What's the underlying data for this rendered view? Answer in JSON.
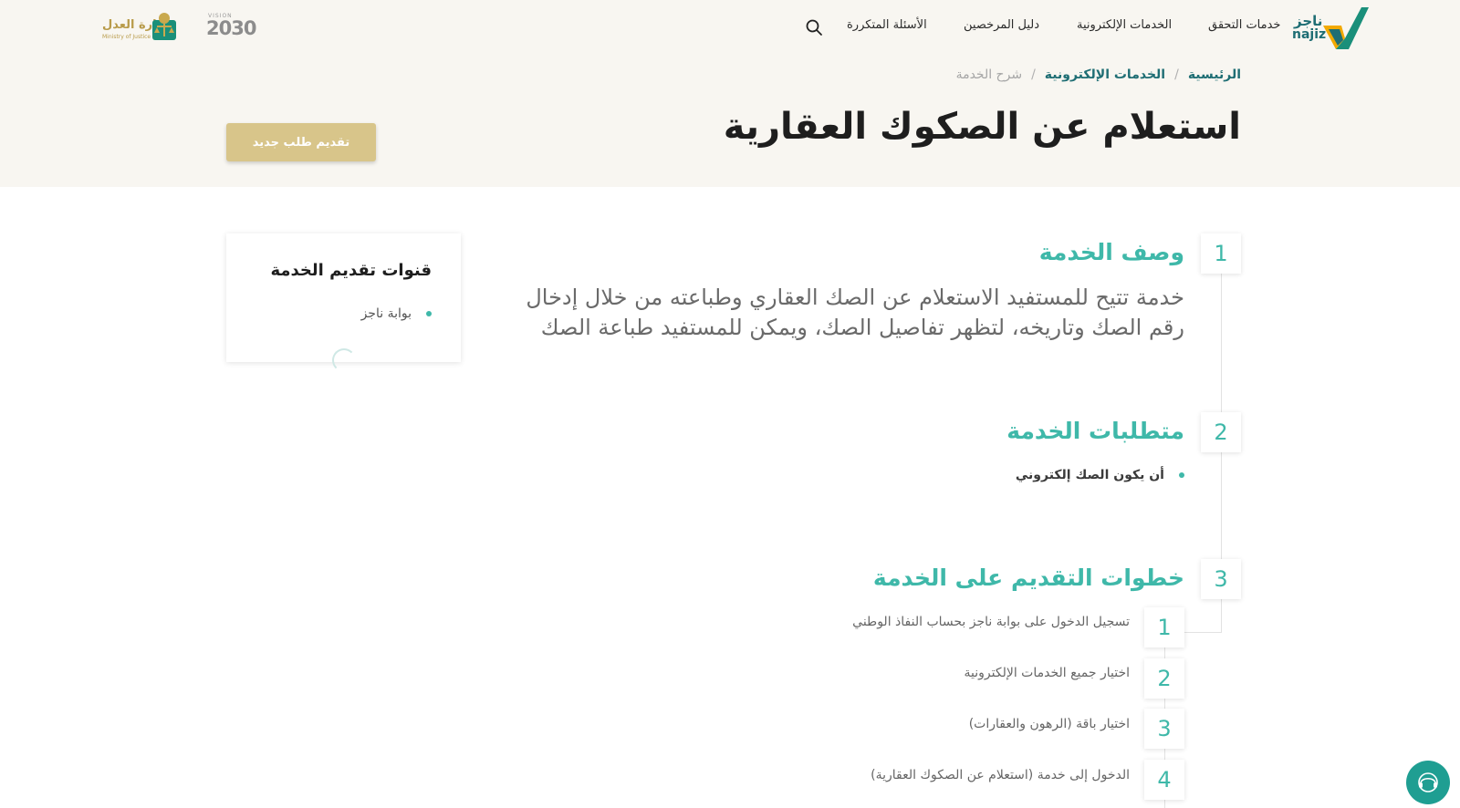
{
  "header": {
    "logo": {
      "ar": "ناجز",
      "en": "najiz"
    },
    "nav_items": [
      {
        "label": "خدمات التحقق"
      },
      {
        "label": "الخدمات الإلكترونية"
      },
      {
        "label": "دليل المرخصين"
      },
      {
        "label": "الأسئلة المتكررة"
      }
    ],
    "icons": {
      "search": "search-icon"
    },
    "vision": {
      "label": "VISION",
      "year": "2030"
    },
    "ministry": {
      "ar": "وزارة العدل",
      "en": "Ministry of Justice"
    }
  },
  "breadcrumb": {
    "home": "الرئيسية",
    "parent": "الخدمات الإلكترونية",
    "current": "شرح الخدمة",
    "separator": "/"
  },
  "page": {
    "title": "استعلام عن الصكوك العقارية",
    "new_request_label": "تقديم طلب جديد"
  },
  "channels": {
    "title": "قنوات تقديم الخدمة",
    "items": [
      "بوابة ناجز"
    ]
  },
  "sections": [
    {
      "number": "1",
      "title": "وصف الخدمة",
      "description": "خدمة تتيح للمستفيد الاستعلام عن الصك العقاري وطباعته من خلال إدخال رقم الصك وتاريخه، لتظهر تفاصيل الصك، ويمكن للمستفيد طباعة الصك"
    },
    {
      "number": "2",
      "title": "متطلبات الخدمة",
      "requirements": [
        "أن يكون الصك إلكتروني"
      ]
    },
    {
      "number": "3",
      "title": "خطوات التقديم على الخدمة",
      "steps": [
        {
          "number": "1",
          "text": "تسجيل الدخول على بوابة ناجز بحساب النفاذ الوطني"
        },
        {
          "number": "2",
          "text": "اختيار جميع الخدمات الإلكترونية"
        },
        {
          "number": "3",
          "text": "اختيار باقة (الرهون والعقارات)"
        },
        {
          "number": "4",
          "text": "الدخول إلى خدمة (استعلام عن الصكوك العقارية)"
        }
      ]
    }
  ],
  "colors": {
    "accent": "#3fb8a9",
    "brand_dark": "#1f6e74",
    "button_gold": "#d8c58a",
    "hero_bg": "#f8f6f1"
  },
  "chat": {
    "icon": "headset-icon"
  }
}
